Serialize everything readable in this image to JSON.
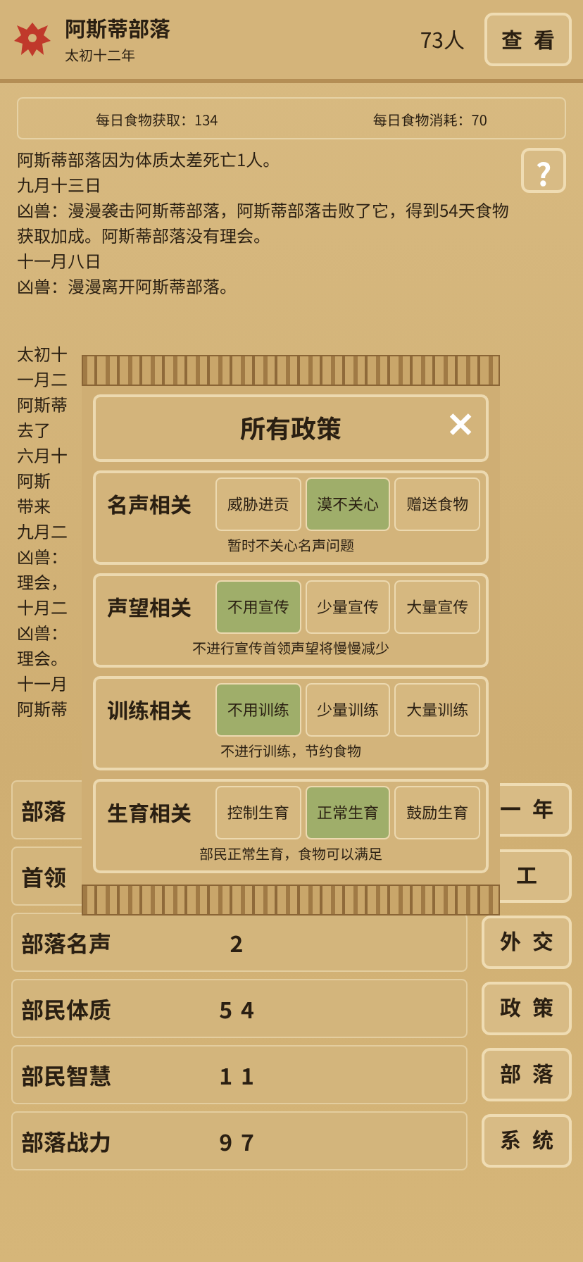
{
  "header": {
    "tribe_name": "阿斯蒂部落",
    "era": "太初十二年",
    "population": "73人",
    "menu_button": "查看"
  },
  "food_bar": {
    "income": "每日食物获取：134",
    "consumption": "每日食物消耗：70"
  },
  "log": [
    "阿斯蒂部落因为体质太差死亡1人。",
    "九月十三日",
    "凶兽：漫漫袭击阿斯蒂部落，阿斯蒂部落击败了它，得到54天食物获取加成。阿斯蒂部落没有理会。",
    "十一月八日",
    "凶兽：漫漫离开阿斯蒂部落。"
  ],
  "help_button": "?",
  "log_behind": [
    "太初十",
    "一月二",
    "阿斯蒂",
    "去了",
    "六月十",
    "阿斯",
    "带来",
    "九月二",
    "凶兽：",
    "理会，",
    "十月二",
    "凶兽：",
    "理会。",
    "十一月",
    "阿斯蒂"
  ],
  "stats": [
    {
      "label": "部落",
      "button": "一年"
    },
    {
      "label": "首领",
      "button": "工"
    },
    {
      "label": "部落名声",
      "value": "2",
      "button": "外交"
    },
    {
      "label": "部民体质",
      "value": "54",
      "button": "政策"
    },
    {
      "label": "部民智慧",
      "value": "11",
      "button": "部落"
    },
    {
      "label": "部落战力",
      "value": "97",
      "button": "系统"
    }
  ],
  "policy_dialog": {
    "title": "所有政策",
    "close": "✕",
    "groups": [
      {
        "label": "名声相关",
        "options": [
          {
            "label": "威胁进贡",
            "selected": false
          },
          {
            "label": "漠不关心",
            "selected": true
          },
          {
            "label": "赠送食物",
            "selected": false
          }
        ],
        "description": "暂时不关心名声问题"
      },
      {
        "label": "声望相关",
        "options": [
          {
            "label": "不用宣传",
            "selected": true
          },
          {
            "label": "少量宣传",
            "selected": false
          },
          {
            "label": "大量宣传",
            "selected": false
          }
        ],
        "description": "不进行宣传首领声望将慢慢减少"
      },
      {
        "label": "训练相关",
        "options": [
          {
            "label": "不用训练",
            "selected": true
          },
          {
            "label": "少量训练",
            "selected": false
          },
          {
            "label": "大量训练",
            "selected": false
          }
        ],
        "description": "不进行训练，节约食物"
      },
      {
        "label": "生育相关",
        "options": [
          {
            "label": "控制生育",
            "selected": false
          },
          {
            "label": "正常生育",
            "selected": true
          },
          {
            "label": "鼓励生育",
            "selected": false
          }
        ],
        "description": "部民正常生育，食物可以满足"
      }
    ]
  }
}
